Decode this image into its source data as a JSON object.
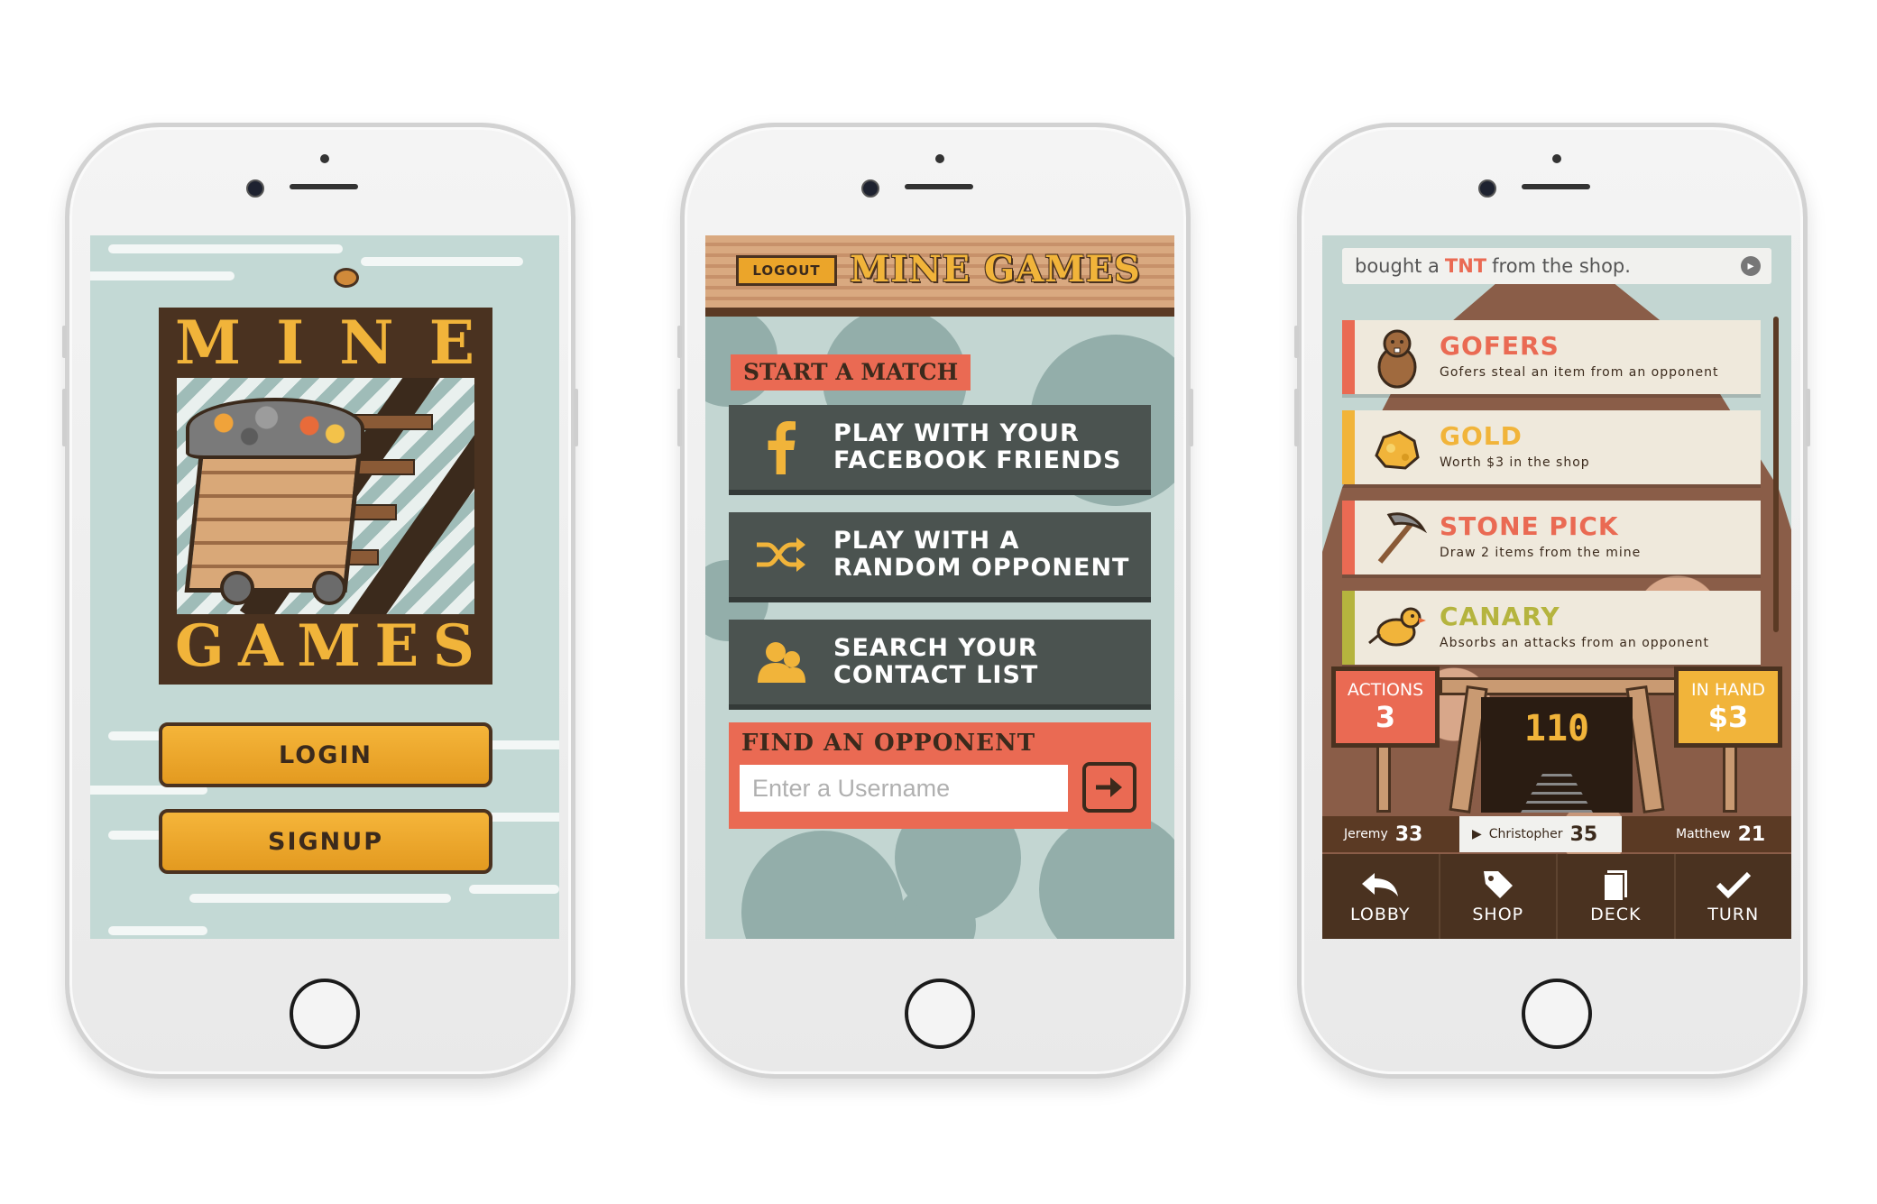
{
  "colors": {
    "accent_orange": "#f1b43a",
    "accent_red": "#ea6a53",
    "dark_brown": "#4a3220",
    "slate": "#4b5350",
    "teal_bg": "#c3d6d2"
  },
  "screen1": {
    "logo_top": [
      "M",
      "I",
      "N",
      "E"
    ],
    "logo_bottom": [
      "G",
      "A",
      "M",
      "E",
      "S"
    ],
    "login_label": "LOGIN",
    "signup_label": "SIGNUP"
  },
  "screen2": {
    "logout_label": "LOGOUT",
    "title": "MINE GAMES",
    "start_match": "START A MATCH",
    "options": [
      {
        "line1": "PLAY WITH YOUR",
        "line2": "FACEBOOK FRIENDS",
        "icon": "facebook-icon"
      },
      {
        "line1": "PLAY WITH A",
        "line2": "RANDOM OPPONENT",
        "icon": "shuffle-icon"
      },
      {
        "line1": "SEARCH YOUR",
        "line2": "CONTACT LIST",
        "icon": "contacts-icon"
      }
    ],
    "find_title": "FIND AN OPPONENT",
    "username_placeholder": "Enter a Username"
  },
  "screen3": {
    "notification": {
      "prefix": "bought a",
      "highlight": "TNT",
      "suffix": "from the shop."
    },
    "cards": [
      {
        "title": "GOFERS",
        "desc": "Gofers steal an item from an opponent",
        "color": "#ea6a53",
        "icon": "gopher-icon"
      },
      {
        "title": "GOLD",
        "desc": "Worth $3 in the shop",
        "color": "#f1b43a",
        "icon": "gold-nugget-icon"
      },
      {
        "title": "STONE PICK",
        "desc": "Draw 2 items from the mine",
        "color": "#ea6a53",
        "icon": "pickaxe-icon"
      },
      {
        "title": "CANARY",
        "desc": "Absorbs an attacks from an opponent",
        "color": "#b5b43e",
        "icon": "canary-icon"
      }
    ],
    "actions_label": "ACTIONS",
    "actions_value": "3",
    "score": "110",
    "in_hand_label": "IN HAND",
    "in_hand_value": "$3",
    "players": [
      {
        "name": "Jeremy",
        "score": "33",
        "active": false
      },
      {
        "name": "Christopher",
        "score": "35",
        "active": true
      },
      {
        "name": "Matthew",
        "score": "21",
        "active": false
      }
    ],
    "tabs": [
      {
        "label": "LOBBY",
        "icon": "back-arrow-icon"
      },
      {
        "label": "SHOP",
        "icon": "tag-icon"
      },
      {
        "label": "DECK",
        "icon": "cards-icon"
      },
      {
        "label": "TURN",
        "icon": "checkmark-icon"
      }
    ]
  }
}
